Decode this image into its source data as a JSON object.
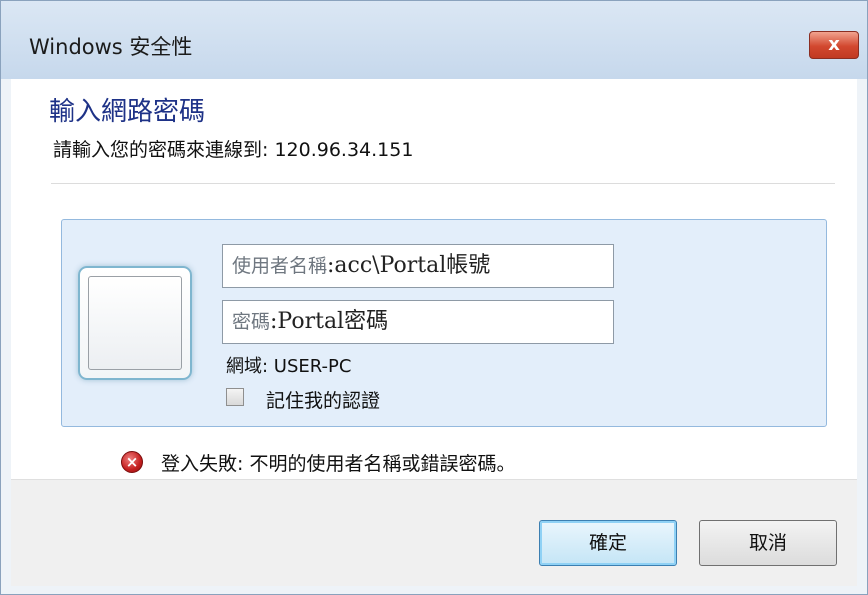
{
  "window": {
    "title": "Windows 安全性",
    "close_label": "x"
  },
  "dialog": {
    "heading": "輸入網路密碼",
    "subtitle": "請輸入您的密碼來連線到: 120.96.34.151"
  },
  "credentials": {
    "username": {
      "label": "使用者名稱",
      "value": ":acc\\Portal帳號"
    },
    "password": {
      "label": "密碼",
      "value": ":Portal密碼"
    },
    "domain": "網域: USER-PC",
    "remember_label": "記住我的認證",
    "remember_checked": false
  },
  "error": {
    "icon": "error-x-icon",
    "message": "登入失敗: 不明的使用者名稱或錯誤密碼。"
  },
  "buttons": {
    "ok": "確定",
    "cancel": "取消"
  }
}
